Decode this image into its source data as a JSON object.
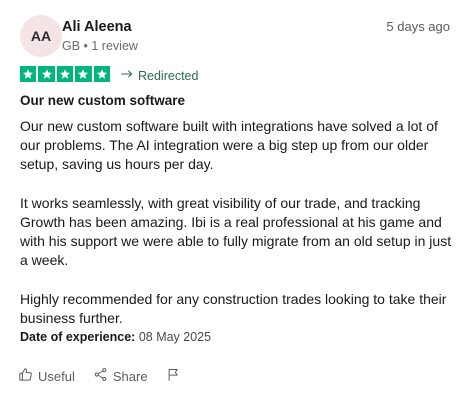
{
  "reviewer": {
    "initials": "AA",
    "name": "Ali Aleena",
    "meta": "GB • 1 review",
    "date_ago": "5 days ago"
  },
  "rating": {
    "stars": 5,
    "max": 5,
    "color": "#00b67a"
  },
  "redirected_label": "Redirected",
  "review": {
    "title": "Our new custom software",
    "paragraphs": [
      "Our new custom software built with integrations have solved a lot of our problems. The AI integration were a big step up from our older setup, saving us hours per day.",
      "It works seamlessly, with great visibility of our trade, and tracking Growth has been amazing. Ibi is a real professional at his game and with his support we were able to fully migrate from an old setup in just a week.",
      "Highly recommended for any construction trades looking to take their business further."
    ]
  },
  "experience": {
    "label": "Date of experience:",
    "date": "08 May 2025"
  },
  "actions": {
    "useful_label": "Useful",
    "share_label": "Share"
  },
  "icons": {
    "star": "star-icon",
    "redirect": "arrow-right-icon",
    "useful": "thumbs-up-icon",
    "share": "share-icon",
    "report": "flag-icon"
  }
}
